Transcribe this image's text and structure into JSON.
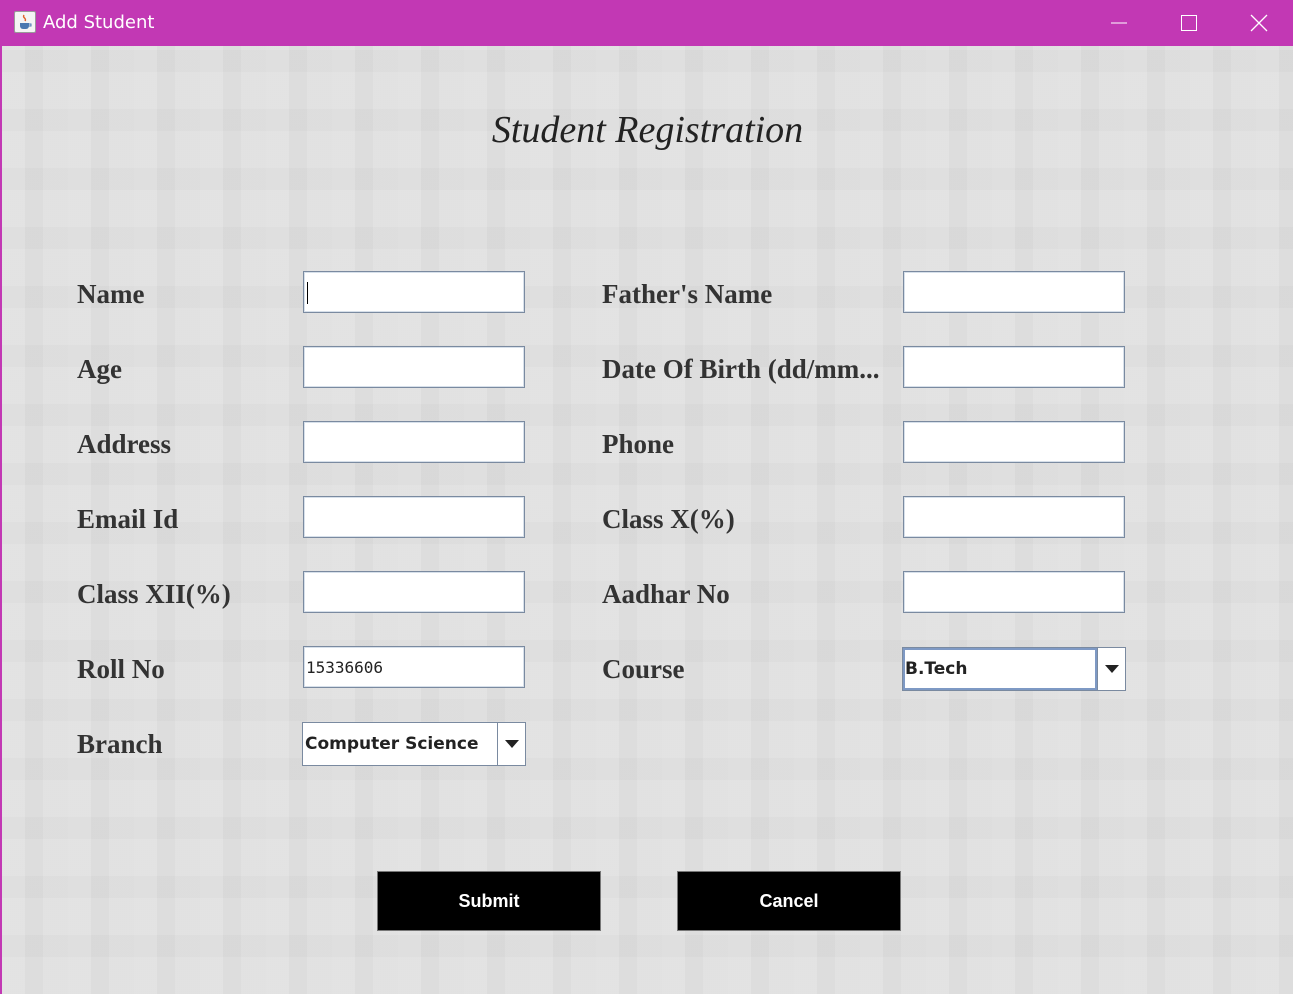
{
  "window": {
    "title": "Add Student",
    "icon": "java-cup-icon",
    "controls": [
      "minimize-icon",
      "maximize-icon",
      "close-icon"
    ],
    "titlebar_color": "#c238b4"
  },
  "form": {
    "heading": "Student Registration",
    "left": [
      {
        "label": "Name",
        "value": ""
      },
      {
        "label": "Age",
        "value": ""
      },
      {
        "label": "Address",
        "value": ""
      },
      {
        "label": "Email Id",
        "value": ""
      },
      {
        "label": "Class XII(%)",
        "value": ""
      },
      {
        "label": "Roll No",
        "value": "15336606"
      },
      {
        "label": "Branch",
        "value": "Computer Science"
      }
    ],
    "right": [
      {
        "label": "Father's Name",
        "value": ""
      },
      {
        "label": "Date Of Birth (dd/mm...",
        "value": ""
      },
      {
        "label": "Phone",
        "value": ""
      },
      {
        "label": "Class X(%)",
        "value": ""
      },
      {
        "label": "Aadhar No",
        "value": ""
      },
      {
        "label": "Course",
        "value": "B.Tech"
      }
    ]
  },
  "buttons": {
    "submit": "Submit",
    "cancel": "Cancel"
  }
}
